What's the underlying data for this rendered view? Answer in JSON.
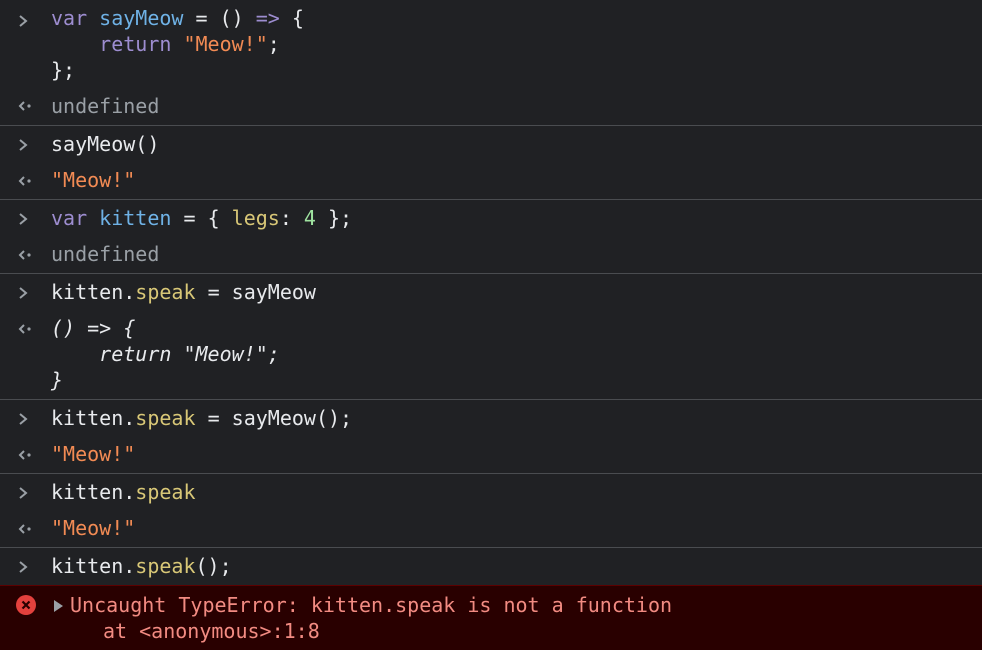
{
  "console": {
    "entries": [
      {
        "input": [
          "var",
          "sayMeow",
          "=",
          "()",
          "=>",
          "{",
          "return",
          "\"Meow!\"",
          ";",
          "};"
        ],
        "output": "undefined"
      },
      {
        "input": [
          "sayMeow()"
        ],
        "output": "\"Meow!\""
      },
      {
        "input": [
          "var",
          "kitten",
          "=",
          "{",
          "legs",
          ":",
          "4",
          "};"
        ],
        "output": "undefined"
      },
      {
        "input": [
          "kitten",
          ".",
          "speak",
          "=",
          "sayMeow"
        ],
        "output_lines": [
          "() => {",
          "return \"Meow!\";",
          "}"
        ]
      },
      {
        "input": [
          "kitten",
          ".",
          "speak",
          "=",
          "sayMeow();"
        ],
        "output": "\"Meow!\""
      },
      {
        "input": [
          "kitten",
          ".",
          "speak"
        ],
        "output": "\"Meow!\""
      },
      {
        "input": [
          "kitten",
          ".",
          "speak",
          "();"
        ]
      }
    ],
    "error": {
      "message": "Uncaught TypeError: kitten.speak is not a function",
      "stack": "at <anonymous>:1:8"
    }
  },
  "colors": {
    "background": "#202124",
    "keyword": "#9d8dd0",
    "identifier": "#6fb2e6",
    "string": "#f28b54",
    "property": "#d8c777",
    "number": "#9fe3a0",
    "error_bg": "#290000",
    "error_text": "#f28b82"
  },
  "icons": {
    "prompt": "chevron-right-icon",
    "result": "return-arrow-icon",
    "error": "error-circle-icon",
    "expand": "expand-triangle-icon"
  }
}
